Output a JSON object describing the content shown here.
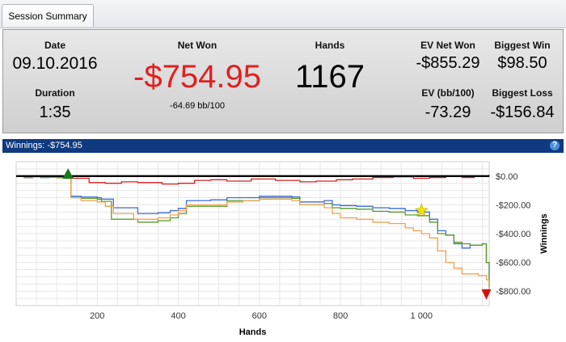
{
  "tabs": [
    {
      "label": "Session Summary"
    }
  ],
  "summary": {
    "date_label": "Date",
    "date_value": "09.10.2016",
    "duration_label": "Duration",
    "duration_value": "1:35",
    "net_won_label": "Net Won",
    "net_won_value": "-$754.95",
    "net_won_bb": "-64.69 bb/100",
    "hands_label": "Hands",
    "hands_value": "1167",
    "ev_net_won_label": "EV Net Won",
    "ev_net_won_value": "-$855.29",
    "ev_bb_label": "EV (bb/100)",
    "ev_bb_value": "-73.29",
    "biggest_win_label": "Biggest Win",
    "biggest_win_value": "$98.50",
    "biggest_loss_label": "Biggest Loss",
    "biggest_loss_value": "-$156.84"
  },
  "chart_header": {
    "title": "Winnings: -$754.95",
    "help": "?"
  },
  "colors": {
    "net_won": "#e02020",
    "header_bg": "#103a80"
  },
  "chart_data": {
    "type": "line",
    "xlabel": "Hands",
    "ylabel": "Winnings",
    "xlim": [
      0,
      1167
    ],
    "ylim": [
      -900,
      100
    ],
    "x_ticks": [
      200,
      400,
      600,
      800,
      1000
    ],
    "x_tick_labels": [
      "200",
      "400",
      "600",
      "800",
      "1 000"
    ],
    "y_ticks": [
      0,
      -200,
      -400,
      -600,
      -800
    ],
    "y_tick_labels": [
      "$0.00",
      "-$200.00",
      "-$400.00",
      "-$600.00",
      "-$800.00"
    ],
    "grid": true,
    "markers": [
      {
        "type": "triangle-up",
        "x": 128,
        "y": 15,
        "color": "#1a7a1a"
      },
      {
        "type": "star",
        "x": 1000,
        "y": -240,
        "color": "#f2e200"
      },
      {
        "type": "triangle-down",
        "x": 1160,
        "y": -820,
        "color": "#d01010"
      }
    ],
    "series": [
      {
        "color": "#d82020",
        "x": [
          0,
          20,
          40,
          60,
          80,
          100,
          125,
          140,
          180,
          220,
          260,
          300,
          360,
          400,
          440,
          480,
          520,
          580,
          640,
          700,
          740,
          790,
          830,
          880,
          930,
          980,
          1020,
          1060,
          1100,
          1130,
          1167
        ],
        "values": [
          0,
          -10,
          0,
          -5,
          -3,
          -5,
          0,
          -15,
          -45,
          -50,
          -40,
          -45,
          -55,
          -50,
          -30,
          -25,
          -35,
          -20,
          -30,
          -40,
          -35,
          -25,
          -20,
          -10,
          -5,
          -15,
          -10,
          0,
          -10,
          0,
          10
        ]
      },
      {
        "color": "#3a6ad8",
        "x": [
          0,
          20,
          40,
          60,
          80,
          100,
          128,
          135,
          160,
          200,
          210,
          240,
          300,
          350,
          380,
          400,
          420,
          480,
          520,
          600,
          680,
          700,
          760,
          780,
          800,
          840,
          880,
          920,
          960,
          990,
          1020,
          1040,
          1060,
          1080,
          1100,
          1120,
          1150,
          1160,
          1167
        ],
        "values": [
          0,
          -10,
          -5,
          -10,
          -8,
          -12,
          -10,
          -140,
          -145,
          -150,
          -160,
          -220,
          -260,
          -255,
          -240,
          -225,
          -170,
          -165,
          -150,
          -140,
          -145,
          -180,
          -170,
          -200,
          -205,
          -210,
          -220,
          -225,
          -240,
          -250,
          -300,
          -380,
          -410,
          -470,
          -500,
          -480,
          -470,
          -600,
          -780
        ]
      },
      {
        "color": "#5a9a2a",
        "x": [
          0,
          20,
          40,
          60,
          80,
          100,
          128,
          135,
          160,
          200,
          210,
          235,
          300,
          350,
          380,
          400,
          420,
          480,
          520,
          600,
          680,
          700,
          760,
          780,
          800,
          840,
          880,
          920,
          960,
          990,
          1020,
          1040,
          1060,
          1080,
          1100,
          1120,
          1150,
          1160,
          1167
        ],
        "values": [
          0,
          -10,
          -5,
          -10,
          -8,
          -12,
          -10,
          -150,
          -155,
          -160,
          -175,
          -300,
          -320,
          -310,
          -290,
          -260,
          -210,
          -210,
          -170,
          -150,
          -155,
          -200,
          -190,
          -220,
          -225,
          -230,
          -245,
          -250,
          -270,
          -275,
          -320,
          -400,
          -410,
          -460,
          -470,
          -480,
          -470,
          -600,
          -770
        ]
      },
      {
        "color": "#f0a050",
        "x": [
          0,
          20,
          40,
          60,
          80,
          100,
          128,
          135,
          160,
          200,
          220,
          240,
          290,
          350,
          380,
          400,
          420,
          480,
          520,
          560,
          600,
          680,
          700,
          760,
          780,
          800,
          840,
          880,
          920,
          960,
          980,
          1000,
          1020,
          1040,
          1060,
          1080,
          1100,
          1140,
          1160,
          1167
        ],
        "values": [
          0,
          -5,
          -5,
          -5,
          -5,
          -5,
          -5,
          -150,
          -170,
          -180,
          -210,
          -260,
          -300,
          -290,
          -270,
          -240,
          -200,
          -200,
          -180,
          -170,
          -160,
          -170,
          -200,
          -220,
          -260,
          -290,
          -300,
          -320,
          -330,
          -360,
          -380,
          -400,
          -430,
          -520,
          -600,
          -640,
          -680,
          -690,
          -720,
          -800
        ]
      },
      {
        "color": "#000000",
        "x": [
          0,
          1167
        ],
        "values": [
          0,
          0
        ]
      }
    ]
  }
}
